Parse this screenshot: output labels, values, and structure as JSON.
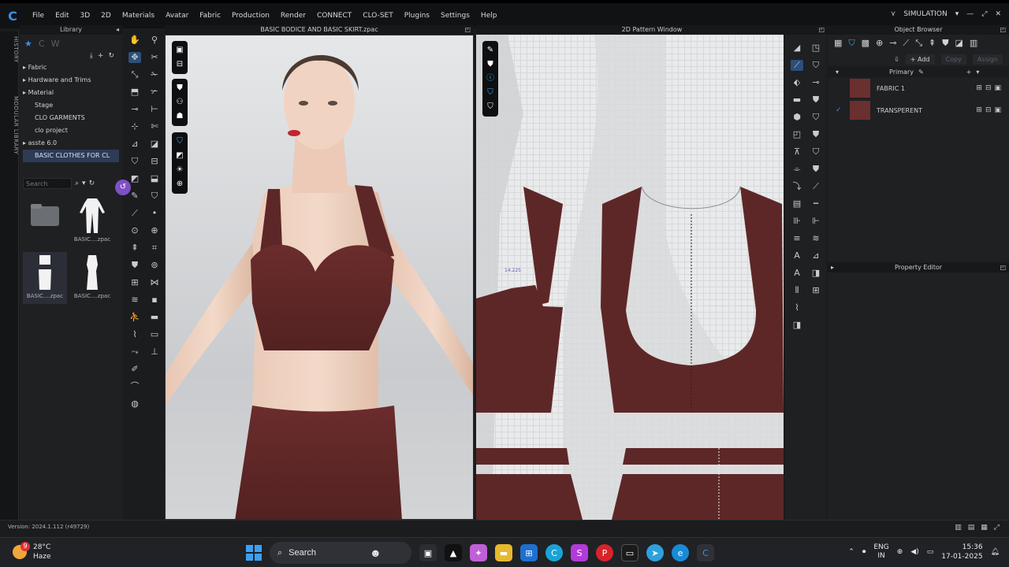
{
  "menubar": {
    "items": [
      "File",
      "Edit",
      "3D",
      "2D",
      "Materials",
      "Avatar",
      "Fabric",
      "Production",
      "Render",
      "CONNECT",
      "CLO-SET",
      "Plugins",
      "Settings",
      "Help"
    ],
    "mode": "SIMULATION"
  },
  "side_tabs": [
    "HISTORY",
    "MODULAR LIBRARY"
  ],
  "library": {
    "title": "Library",
    "tree": [
      "Fabric",
      "Hardware and Trims",
      "Material",
      "Stage",
      "CLO GARMENTS",
      "clo project",
      "asste 6.0",
      "BASIC CLOTHES FOR  CL"
    ],
    "search_placeholder": "Search",
    "thumbs": [
      {
        "caption": ""
      },
      {
        "caption": "BASIC....zpac"
      },
      {
        "caption": "BASIC....zpac"
      },
      {
        "caption": "BASIC....zpac"
      }
    ]
  },
  "view3d": {
    "title": "BASIC BODICE AND BASIC SKIRT.zpac"
  },
  "view2d": {
    "title": "2D Pattern Window",
    "measurement": "14.225"
  },
  "object_browser": {
    "title": "Object Browser",
    "add_label": "Add",
    "copy_label": "Copy",
    "assign_label": "Assign",
    "primary_label": "Primary",
    "fabrics": [
      {
        "name": "FABRIC 1",
        "checked": false
      },
      {
        "name": "TRANSPERENT",
        "checked": true
      }
    ],
    "fabric_color": "#6a2f2f"
  },
  "property_editor": {
    "title": "Property Editor"
  },
  "status": {
    "version": "Version: 2024.1.112 (r49729)"
  },
  "taskbar": {
    "weather_badge": "9",
    "temperature": "28°C",
    "condition": "Haze",
    "search_label": "Search",
    "lang_top": "ENG",
    "lang_bottom": "IN",
    "time": "15:36",
    "date": "17-01-2025"
  }
}
